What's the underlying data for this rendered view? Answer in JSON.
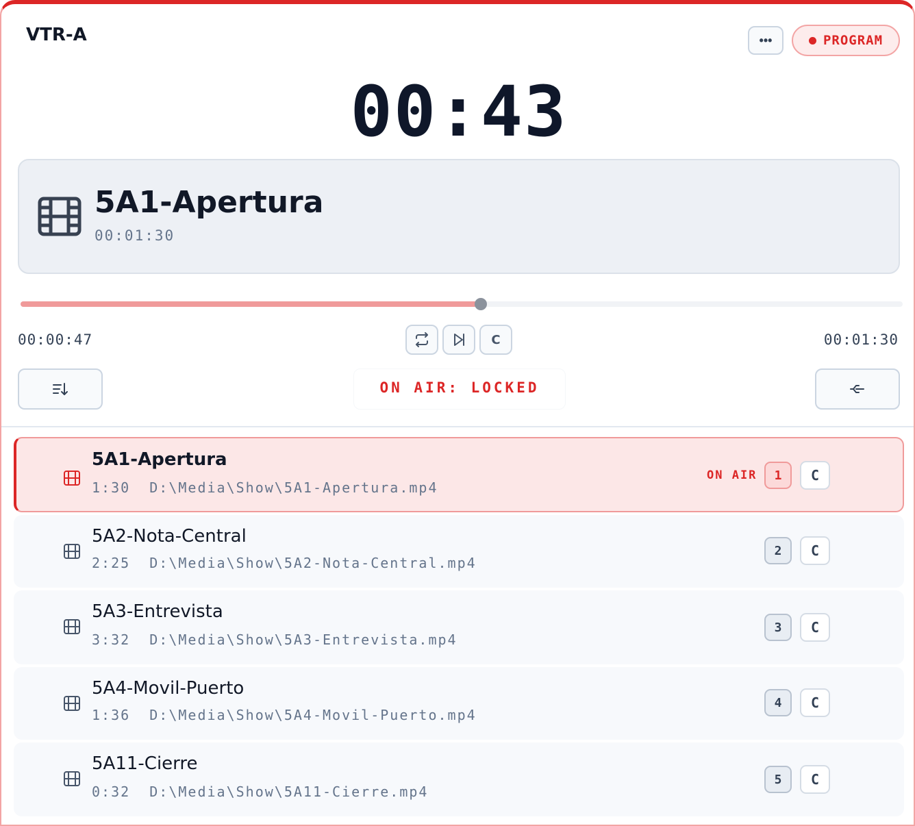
{
  "header": {
    "title": "VTR-A",
    "more_label": "•••",
    "program_label": "PROGRAM"
  },
  "clock": "00:43",
  "now_playing": {
    "title": "5A1-Apertura",
    "duration": "00:01:30"
  },
  "progress": {
    "fraction": 0.522,
    "elapsed": "00:00:47",
    "total": "00:01:30"
  },
  "transport": {
    "cue_label": "C"
  },
  "status": {
    "locked_text": "ON AIR: LOCKED"
  },
  "clips": [
    {
      "title": "5A1-Apertura",
      "duration": "1:30",
      "path": "D:\\Media\\Show\\5A1-Apertura.mp4",
      "number": "1",
      "cue": "C",
      "on_air": true,
      "on_air_label": "ON AIR"
    },
    {
      "title": "5A2-Nota-Central",
      "duration": "2:25",
      "path": "D:\\Media\\Show\\5A2-Nota-Central.mp4",
      "number": "2",
      "cue": "C",
      "on_air": false
    },
    {
      "title": "5A3-Entrevista",
      "duration": "3:32",
      "path": "D:\\Media\\Show\\5A3-Entrevista.mp4",
      "number": "3",
      "cue": "C",
      "on_air": false
    },
    {
      "title": "5A4-Movil-Puerto",
      "duration": "1:36",
      "path": "D:\\Media\\Show\\5A4-Movil-Puerto.mp4",
      "number": "4",
      "cue": "C",
      "on_air": false
    },
    {
      "title": "5A11-Cierre",
      "duration": "0:32",
      "path": "D:\\Media\\Show\\5A11-Cierre.mp4",
      "number": "5",
      "cue": "C",
      "on_air": false
    }
  ],
  "colors": {
    "accent": "#dc2626",
    "progress_fill": "#f09a9a",
    "active_row_bg": "#fce7e7"
  }
}
